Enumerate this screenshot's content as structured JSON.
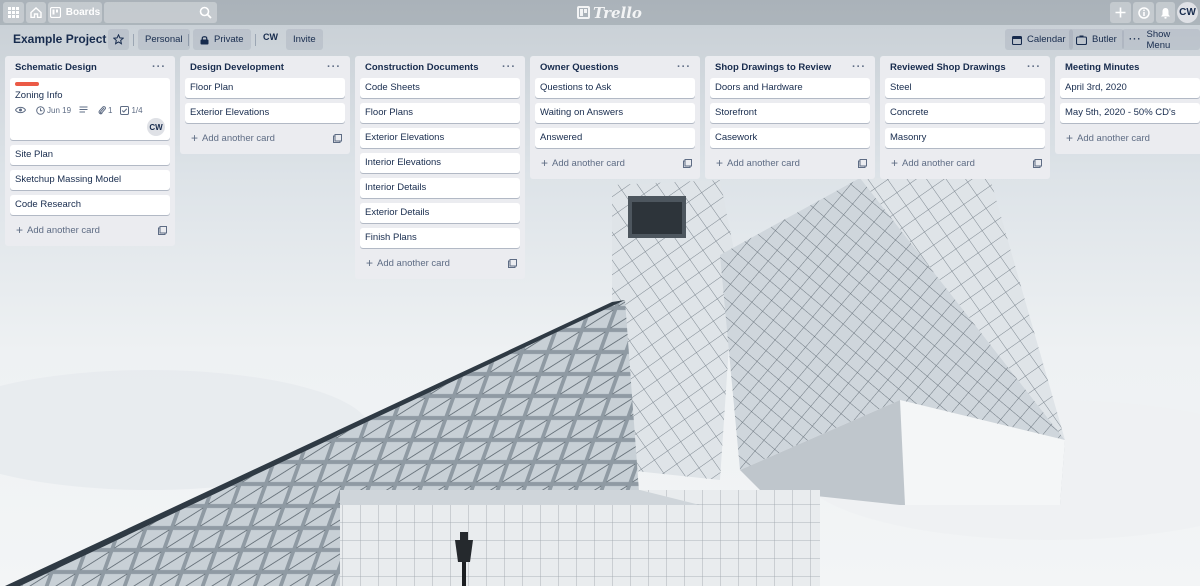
{
  "topbar": {
    "boards_label": "Boards",
    "logo_text": "Trello",
    "avatar_initials": "CW"
  },
  "header": {
    "board_title": "Example Project",
    "personal_label": "Personal",
    "private_label": "Private",
    "member_initials": "CW",
    "invite_label": "Invite",
    "calendar_label": "Calendar",
    "butler_label": "Butler",
    "show_menu_label": "Show Menu"
  },
  "add_card_label": "Add another card",
  "lists": [
    {
      "title": "Schematic Design",
      "featured_card": {
        "label_color": "#eb5a46",
        "title": "Zoning Info",
        "due": "Jun 19",
        "attachments": "1",
        "checklist": "1/4",
        "member": "CW"
      },
      "cards": [
        "Site Plan",
        "Sketchup Massing Model",
        "Code Research"
      ]
    },
    {
      "title": "Design Development",
      "cards": [
        "Floor Plan",
        "Exterior Elevations"
      ]
    },
    {
      "title": "Construction Documents",
      "cards": [
        "Code Sheets",
        "Floor Plans",
        "Exterior Elevations",
        "Interior Elevations",
        "Interior Details",
        "Exterior Details",
        "Finish Plans"
      ]
    },
    {
      "title": "Owner Questions",
      "cards": [
        "Questions to Ask",
        "Waiting on Answers",
        "Answered"
      ]
    },
    {
      "title": "Shop Drawings to Review",
      "cards": [
        "Doors and Hardware",
        "Storefront",
        "Casework"
      ]
    },
    {
      "title": "Reviewed Shop Drawings",
      "cards": [
        "Steel",
        "Concrete",
        "Masonry"
      ]
    },
    {
      "title": "Meeting Minutes",
      "cards": [
        "April 3rd, 2020",
        "May 5th, 2020 - 50% CD's"
      ]
    }
  ]
}
